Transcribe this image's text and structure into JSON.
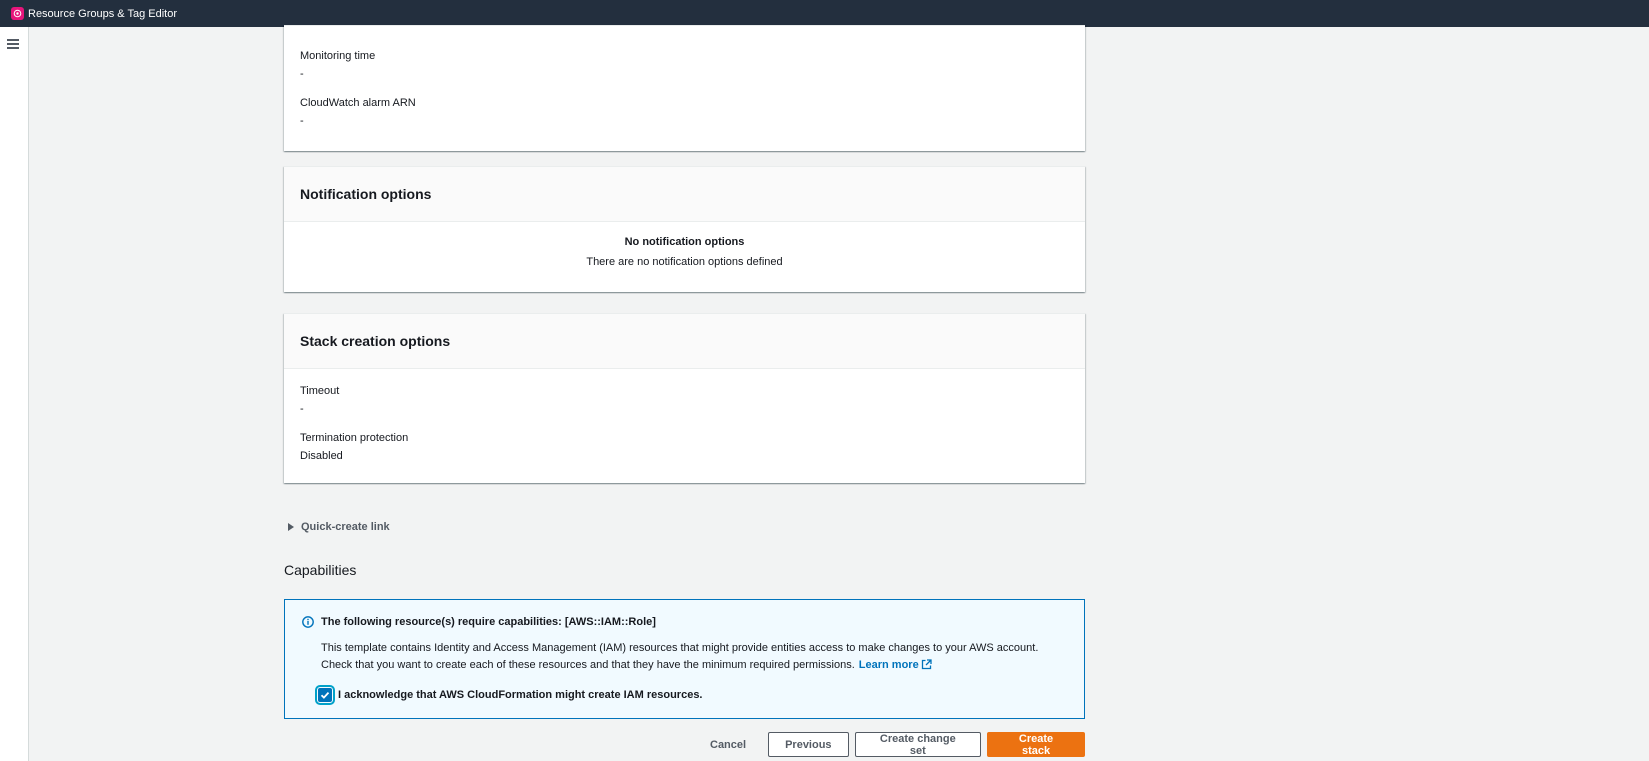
{
  "topbar": {
    "service_name": "Resource Groups & Tag Editor",
    "logo_color": "#e7157b"
  },
  "rollback_section": {
    "fields": [
      {
        "label": "Monitoring time",
        "value": "-"
      },
      {
        "label": "CloudWatch alarm ARN",
        "value": "-"
      }
    ]
  },
  "notification_options": {
    "title": "Notification options",
    "empty_title": "No notification options",
    "empty_description": "There are no notification options defined"
  },
  "stack_creation_options": {
    "title": "Stack creation options",
    "fields": [
      {
        "label": "Timeout",
        "value": "-"
      },
      {
        "label": "Termination protection",
        "value": "Disabled"
      }
    ]
  },
  "quick_create": {
    "label": "Quick-create link"
  },
  "capabilities": {
    "title": "Capabilities",
    "alert_title": "The following resource(s) require capabilities: [AWS::IAM::Role]",
    "alert_body_line1": "This template contains Identity and Access Management (IAM) resources that might provide entities access to make changes to your AWS account.",
    "alert_body_line2": "Check that you want to create each of these resources and that they have the minimum required permissions.",
    "learn_more": "Learn more",
    "acknowledge_label": "I acknowledge that AWS CloudFormation might create IAM resources.",
    "acknowledge_checked": true
  },
  "actions": {
    "cancel": "Cancel",
    "previous": "Previous",
    "create_change_set": "Create change set",
    "create_stack": "Create stack",
    "primary_color": "#ec7211"
  },
  "colors": {
    "header_bg": "#232f3e",
    "link": "#0073bb",
    "page_bg": "#f2f3f3"
  }
}
